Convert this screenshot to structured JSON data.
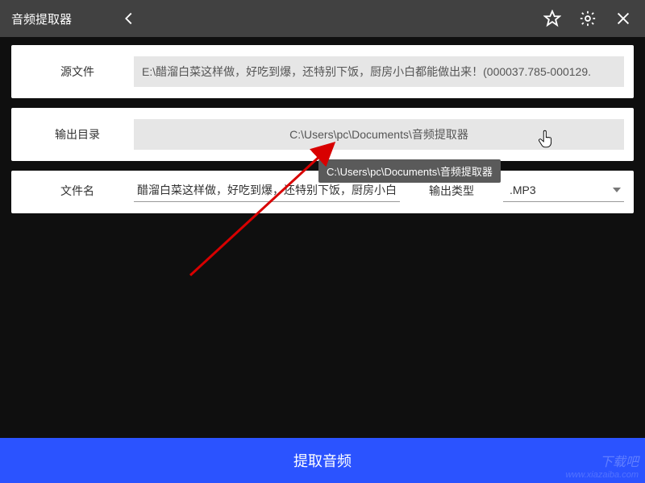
{
  "titlebar": {
    "title": "音频提取器"
  },
  "panels": {
    "source": {
      "label": "源文件",
      "value": "E:\\醋溜白菜这样做，好吃到爆，还特别下饭，厨房小白都能做出来！(000037.785-000129."
    },
    "output_dir": {
      "label": "输出目录",
      "value": "C:\\Users\\pc\\Documents\\音频提取器"
    },
    "filename": {
      "label": "文件名",
      "value": "醋溜白菜这样做，好吃到爆，还特别下饭，厨房小白"
    },
    "output_type": {
      "label": "输出类型",
      "value": ".MP3"
    }
  },
  "tooltip": "C:\\Users\\pc\\Documents\\音频提取器",
  "extract_button": "提取音频",
  "watermark": {
    "main": "下载吧",
    "sub": "www.xiazaiba.com"
  }
}
